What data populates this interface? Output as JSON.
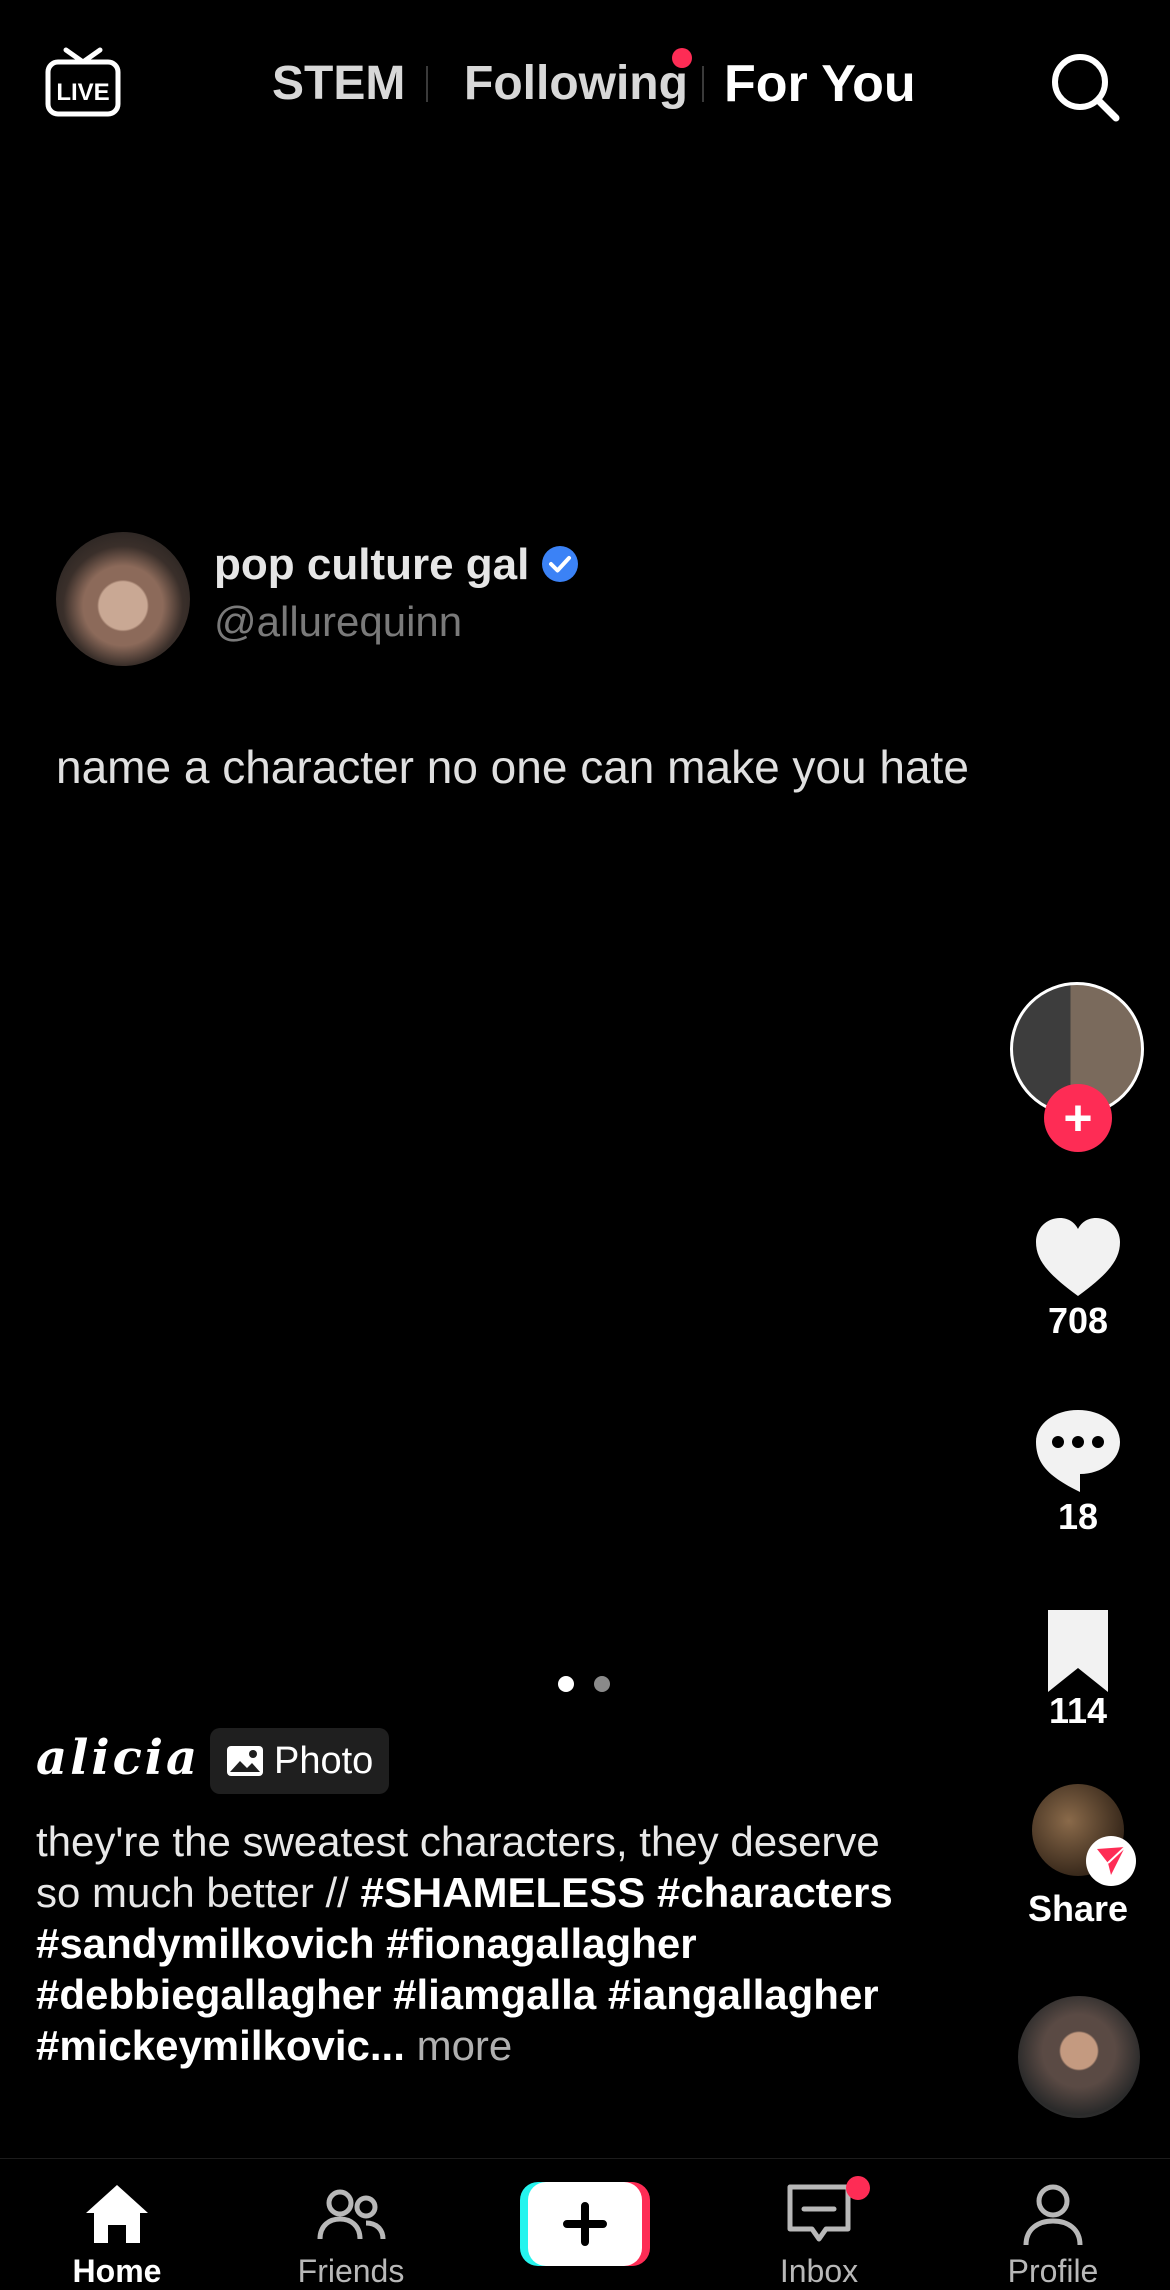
{
  "header": {
    "tabs": [
      "STEM",
      "Following",
      "For You"
    ],
    "active_tab": "For You"
  },
  "tweet": {
    "name": "pop culture gal",
    "handle": "@allurequinn",
    "text": "name a character no one can make you hate"
  },
  "rail": {
    "likes": "708",
    "comments": "18",
    "bookmarks": "114",
    "share_label": "Share"
  },
  "pagination": {
    "current": 1,
    "total": 2
  },
  "caption": {
    "author": "alicia",
    "badge": "Photo",
    "text": "they're the sweatest characters, they deserve so much better //",
    "hashtags": "#SHAMELESS #characters #sandymilkovich #fionagallagher #debbiegallagher #liamgalla #iangallagher #mickeymilkovic...",
    "more": "more"
  },
  "nav": {
    "items": [
      {
        "label": "Home"
      },
      {
        "label": "Friends"
      },
      {
        "label": ""
      },
      {
        "label": "Inbox"
      },
      {
        "label": "Profile"
      }
    ]
  },
  "colors": {
    "accent": "#fe2c55",
    "verified": "#3b82f6",
    "background": "#000000"
  }
}
